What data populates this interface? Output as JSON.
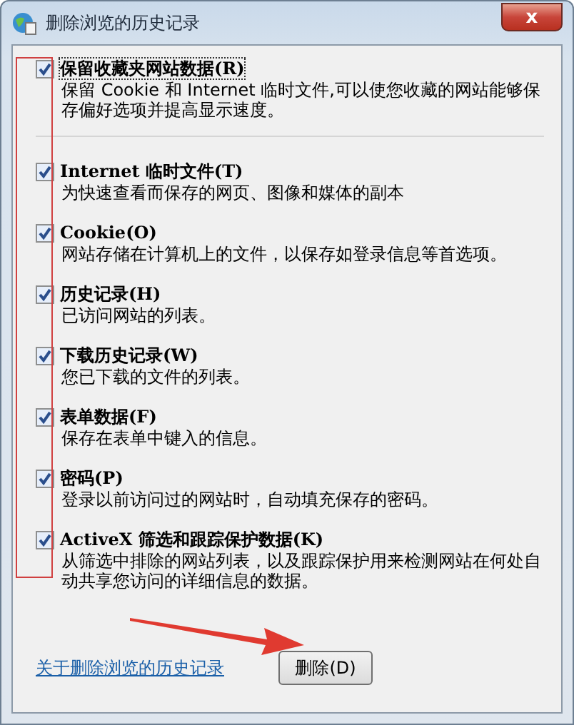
{
  "window": {
    "title": "删除浏览的历史记录",
    "close": "x"
  },
  "options": [
    {
      "label": "保留收藏夹网站数据(R)",
      "checked": true,
      "focused": true,
      "description": "保留 Cookie 和 Internet 临时文件,可以使您收藏的网站能够保存偏好选项并提高显示速度。"
    },
    {
      "label": "Internet 临时文件(T)",
      "checked": true,
      "focused": false,
      "description": "为快速查看而保存的网页、图像和媒体的副本"
    },
    {
      "label": "Cookie(O)",
      "checked": true,
      "focused": false,
      "description": "网站存储在计算机上的文件，以保存如登录信息等首选项。"
    },
    {
      "label": "历史记录(H)",
      "checked": true,
      "focused": false,
      "description": "已访问网站的列表。"
    },
    {
      "label": "下载历史记录(W)",
      "checked": true,
      "focused": false,
      "description": "您已下载的文件的列表。"
    },
    {
      "label": "表单数据(F)",
      "checked": true,
      "focused": false,
      "description": "保存在表单中键入的信息。"
    },
    {
      "label": "密码(P)",
      "checked": true,
      "focused": false,
      "description": "登录以前访问过的网站时，自动填充保存的密码。"
    },
    {
      "label": "ActiveX 筛选和跟踪保护数据(K)",
      "checked": true,
      "focused": false,
      "description": "从筛选中排除的网站列表，以及跟踪保护用来检测网站在何处自动共享您访问的详细信息的数据。"
    }
  ],
  "footer": {
    "link": "关于删除浏览的历史记录",
    "button": "删除(D)"
  }
}
